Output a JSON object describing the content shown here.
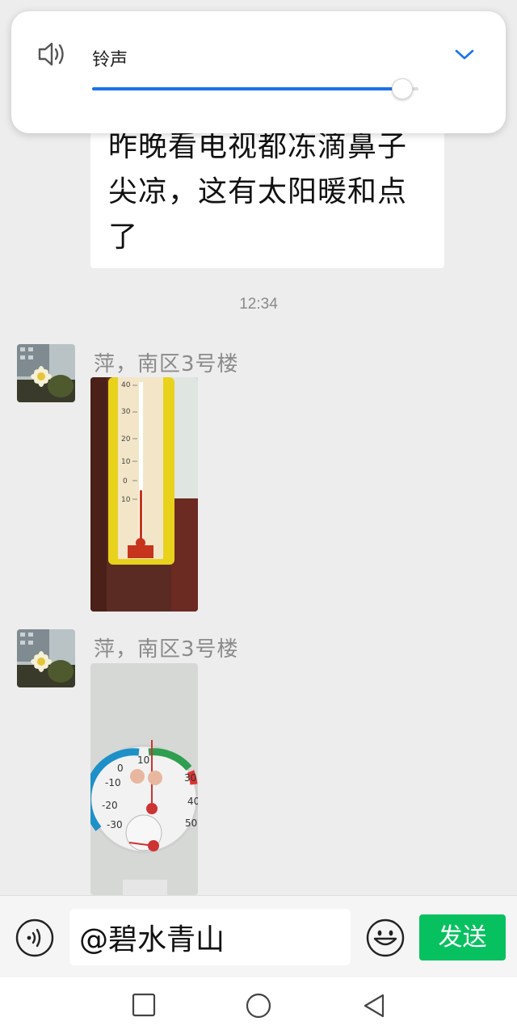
{
  "volume_panel": {
    "icon": "speaker-icon",
    "label": "铃声",
    "level": 0.95,
    "accent": "#1a73e8",
    "expand_icon": "chevron-down-icon"
  },
  "messages": {
    "text_bubble": {
      "lines": [
        "昨晚看电视都冻滴鼻子",
        "尖凉，这有太阳暖和点",
        "了"
      ]
    },
    "timestamp": "12:34",
    "items": [
      {
        "sender": "萍，南区3号楼",
        "content": "thermometer-photo"
      },
      {
        "sender": "萍，南区3号楼",
        "content": "hygrometer-photo"
      }
    ]
  },
  "photos": {
    "thermometer_scale": [
      "40",
      "30",
      "20",
      "10",
      "0",
      "10"
    ],
    "hygrometer_temp_scale": [
      "10",
      "0",
      "-10",
      "-20",
      "-30",
      "30",
      "40",
      "50"
    ]
  },
  "input_bar": {
    "voice_icon": "voice-icon",
    "input_value": "@碧水青山",
    "emoji_icon": "emoji-icon",
    "send_label": "发送",
    "send_color": "#07c160"
  },
  "nav_bar": {
    "buttons": [
      "recent-apps-icon",
      "home-icon",
      "back-icon"
    ]
  }
}
